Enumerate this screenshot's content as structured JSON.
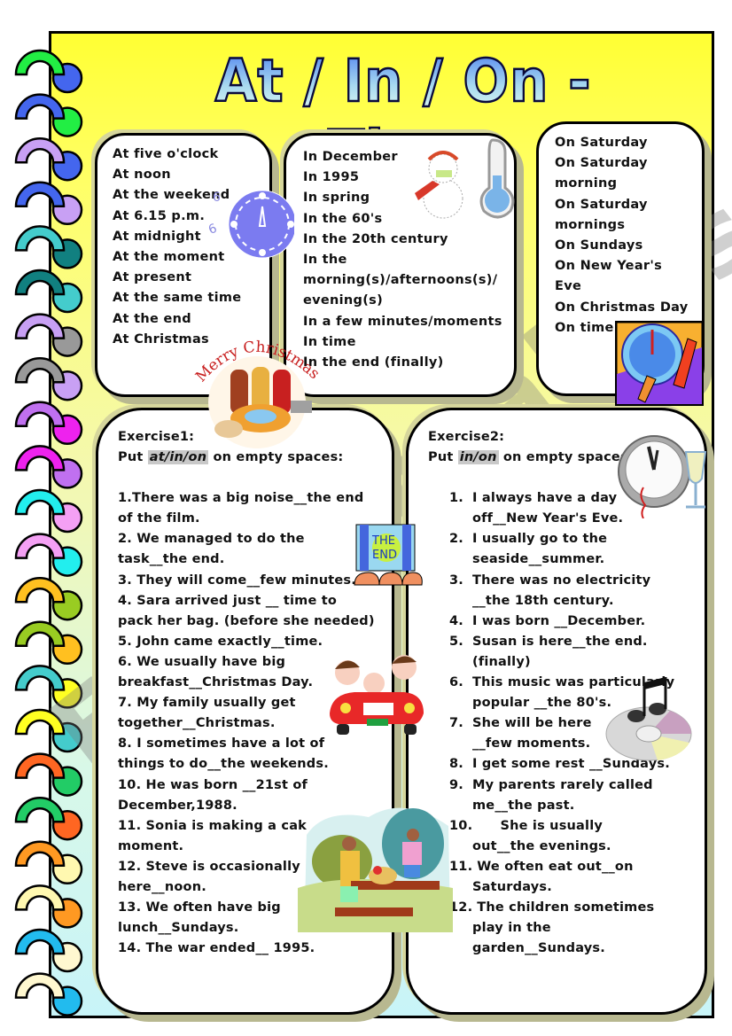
{
  "title": "At / In / On - Time",
  "watermark": "ESLprintables.com",
  "at_box": {
    "items": [
      "At five o'clock",
      "At noon",
      "At the weekend",
      "At 6.15 p.m.",
      "At midnight",
      "At the moment",
      "At present",
      "At the same time",
      "At the end",
      "At Christmas"
    ]
  },
  "in_box": {
    "items": [
      "In December",
      "In 1995",
      "In spring",
      "In the 60's",
      "In the 20th century",
      "In the",
      "morning(s)/afternoons(s)/",
      "evening(s)",
      "In a few minutes/moments",
      "In time",
      "In the end (finally)"
    ]
  },
  "on_box": {
    "items": [
      "On Saturday",
      "On Saturday",
      "morning",
      "On Saturday",
      "mornings",
      "On Sundays",
      "On New Year's",
      "Eve",
      "On Christmas Day",
      "On time"
    ]
  },
  "exercise1": {
    "heading": "Exercise1:",
    "instruction_prefix": "Put ",
    "instruction_highlight": "at/in/on",
    "instruction_suffix": " on empty spaces:",
    "lines": [
      "1.There was a big noise__the end",
      "of the film.",
      "2. We managed to do the",
      "task__the end.",
      "3. They will come__few minutes.",
      "4. Sara arrived just __ time to",
      "pack her bag. (before she needed)",
      "5. John came exactly__time.",
      "6. We usually have big",
      "breakfast__Christmas Day.",
      "7. My family usually get",
      "together__Christmas.",
      "8. I sometimes have a lot of",
      "things to do__the weekends.",
      "10. He was born __21st of",
      "December,1988.",
      "11. Sonia is making a cak",
      "moment.",
      "12. Steve is occasionally",
      "here__noon.",
      "13. We often have big",
      "lunch__Sundays.",
      "14. The war ended__ 1995."
    ]
  },
  "exercise2": {
    "heading": "Exercise2:",
    "instruction_prefix": "Put ",
    "instruction_highlight": "in/on",
    "instruction_suffix": " on empty spaces",
    "items": [
      {
        "num": "1.",
        "lines": [
          "I always have a day",
          "off__New Year's Eve."
        ]
      },
      {
        "num": "2.",
        "lines": [
          "I usually go to the",
          "seaside__summer."
        ]
      },
      {
        "num": "3.",
        "lines": [
          "There was no electricity",
          "__the 18th century."
        ]
      },
      {
        "num": "4.",
        "lines": [
          "I was born __December."
        ]
      },
      {
        "num": "5.",
        "lines": [
          "Susan is here__the end.",
          "(finally)"
        ]
      },
      {
        "num": "6.",
        "lines": [
          "This music was particularly",
          "popular __the 80's."
        ]
      },
      {
        "num": "7.",
        "lines": [
          "She will be here",
          "__few moments."
        ]
      },
      {
        "num": "8.",
        "lines": [
          "I get some rest __Sundays."
        ]
      },
      {
        "num": "9.",
        "lines": [
          "My parents rarely called",
          "me__the past."
        ]
      },
      {
        "num": "10.",
        "lines": [
          "      She is usually",
          "out__the evenings."
        ]
      },
      {
        "num": "11.",
        "lines": [
          " We often eat out__on",
          "Saturdays."
        ]
      },
      {
        "num": "12.",
        "lines": [
          " The children sometimes",
          "play in the",
          "garden__Sundays."
        ]
      }
    ]
  },
  "images": {
    "christmas_banner_text": "Merry Christmas",
    "movie_sign_text_1": "THE",
    "movie_sign_text_2": "END"
  },
  "colors": {
    "page_top": "#ffff33",
    "page_bottom": "#c8f4f8",
    "title_fill_top": "#4a7cf0",
    "title_fill_bottom": "#e8fff0",
    "border": "#000000",
    "spiral_rings": [
      [
        "#22ee44",
        "#4466ee"
      ],
      [
        "#4466ee",
        "#22ee44"
      ],
      [
        "#c8a0f4",
        "#4466ee"
      ],
      [
        "#4466ee",
        "#c8a0f4"
      ],
      [
        "#44cccc",
        "#118080"
      ],
      [
        "#118080",
        "#44cccc"
      ],
      [
        "#c8a0f4",
        "#999999"
      ],
      [
        "#999999",
        "#c8a0f4"
      ],
      [
        "#c070f0",
        "#ee22ee"
      ],
      [
        "#ee22ee",
        "#c070f0"
      ],
      [
        "#22eeee",
        "#f4a0f4"
      ],
      [
        "#f4a0f4",
        "#22eeee"
      ],
      [
        "#ffc020",
        "#99cc22"
      ],
      [
        "#99cc22",
        "#ffc020"
      ],
      [
        "#44cccc",
        "#ffff22"
      ],
      [
        "#ffff22",
        "#44cccc"
      ],
      [
        "#ff6622",
        "#22cc66"
      ],
      [
        "#22cc66",
        "#ff6622"
      ],
      [
        "#ff9922",
        "#fff8b0"
      ],
      [
        "#fff8b0",
        "#ff9922"
      ],
      [
        "#22bbee",
        "#fff8d0"
      ],
      [
        "#fff8d0",
        "#22bbee"
      ]
    ]
  }
}
